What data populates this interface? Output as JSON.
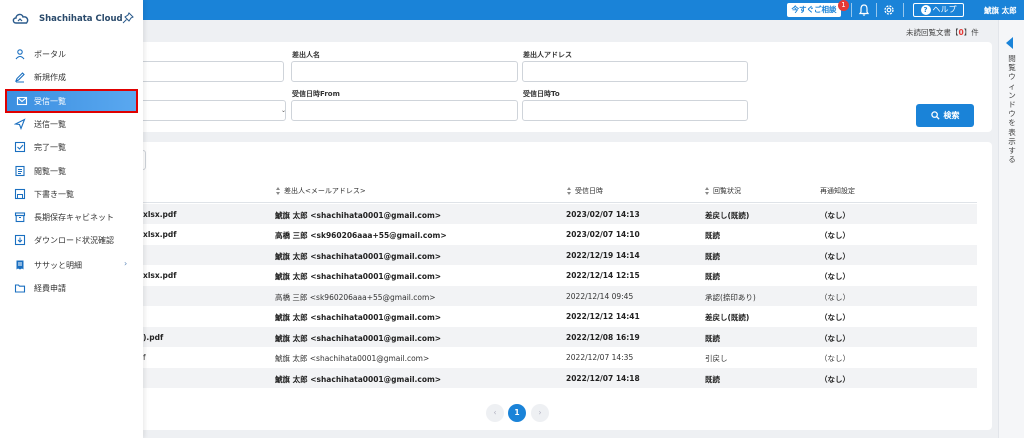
{
  "header": {
    "consult_label": "今すぐご相談",
    "consult_badge": "1",
    "help_label": "ヘルプ",
    "user_name": "鯱旗 太郎"
  },
  "right_panel": {
    "vertical_label": "閲覧ウィンドウを表示する"
  },
  "unread": {
    "prefix": "未読回覧文書【",
    "count": "0",
    "suffix": "】件"
  },
  "search": {
    "sender_name_label": "差出人名",
    "sender_address_label": "差出人アドレス",
    "received_from_label": "受信日時From",
    "received_to_label": "受信日時To",
    "search_button": "検索"
  },
  "table": {
    "columns": {
      "sender": "差出人<メールアドレス>",
      "received": "受信日時",
      "status": "回覧状況",
      "renotify": "再通知設定"
    },
    "rows": [
      {
        "file": "xlsx.pdf",
        "sender": "鯱旗 太郎 <shachihata0001@gmail.com>",
        "received": "2023/02/07 14:13",
        "status": "差戻し(既読)",
        "renotify": "（なし）",
        "bold": true
      },
      {
        "file": "xlsx.pdf",
        "sender": "高橋 三郎 <sk960206aaa+55@gmail.com>",
        "received": "2023/02/07 14:10",
        "status": "既読",
        "renotify": "（なし）",
        "bold": true
      },
      {
        "file": "",
        "sender": "鯱旗 太郎 <shachihata0001@gmail.com>",
        "received": "2022/12/19 14:14",
        "status": "既読",
        "renotify": "（なし）",
        "bold": true
      },
      {
        "file": "xlsx.pdf",
        "sender": "鯱旗 太郎 <shachihata0001@gmail.com>",
        "received": "2022/12/14 12:15",
        "status": "既読",
        "renotify": "（なし）",
        "bold": true
      },
      {
        "file": "",
        "sender": "高橋 三郎 <sk960206aaa+55@gmail.com>",
        "received": "2022/12/14 09:45",
        "status": "承認(捺印あり)",
        "renotify": "（なし）",
        "bold": false
      },
      {
        "file": "",
        "sender": "鯱旗 太郎 <shachihata0001@gmail.com>",
        "received": "2022/12/12 14:41",
        "status": "差戻し(既読)",
        "renotify": "（なし）",
        "bold": true
      },
      {
        "file": ").pdf",
        "sender": "鯱旗 太郎 <shachihata0001@gmail.com>",
        "received": "2022/12/08 16:19",
        "status": "既読",
        "renotify": "（なし）",
        "bold": true
      },
      {
        "file": "f",
        "sender": "鯱旗 太郎 <shachihata0001@gmail.com>",
        "received": "2022/12/07 14:35",
        "status": "引戻し",
        "renotify": "（なし）",
        "bold": false
      },
      {
        "file": "",
        "sender": "鯱旗 太郎 <shachihata0001@gmail.com>",
        "received": "2022/12/07 14:18",
        "status": "既読",
        "renotify": "（なし）",
        "bold": true
      }
    ]
  },
  "pagination": {
    "prev": "‹",
    "current": "1",
    "next": "›"
  },
  "sidebar": {
    "brand": "Shachihata Cloud",
    "items": [
      {
        "label": "ポータル",
        "icon": "person-icon"
      },
      {
        "label": "新規作成",
        "icon": "pencil-icon"
      },
      {
        "label": "受信一覧",
        "icon": "envelope-icon"
      },
      {
        "label": "送信一覧",
        "icon": "send-icon"
      },
      {
        "label": "完了一覧",
        "icon": "checkbox-icon"
      },
      {
        "label": "閲覧一覧",
        "icon": "document-icon"
      },
      {
        "label": "下書き一覧",
        "icon": "save-icon"
      },
      {
        "label": "長期保存キャビネット",
        "icon": "archive-icon"
      },
      {
        "label": "ダウンロード状況確認",
        "icon": "download-icon"
      },
      {
        "label": "ササッと明細",
        "icon": "receipt-icon",
        "chevron": "›"
      },
      {
        "label": "経費申請",
        "icon": "folder-icon"
      }
    ]
  },
  "colors": {
    "primary": "#1a83d8",
    "highlight_border": "#e00000",
    "badge": "#e53935"
  }
}
